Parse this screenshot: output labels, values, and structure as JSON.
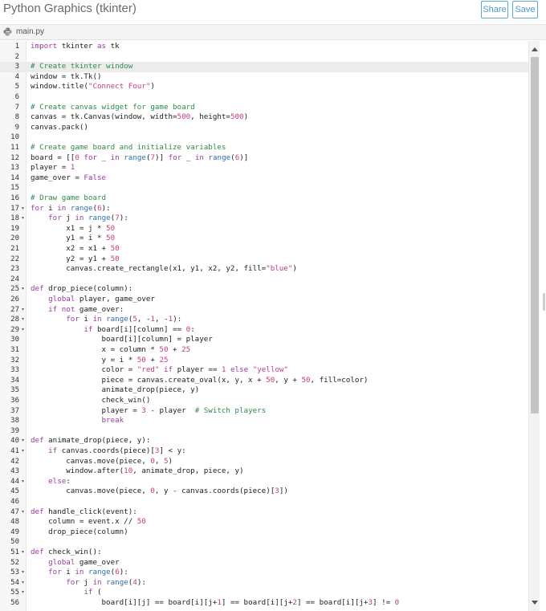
{
  "app": {
    "title": "Python Graphics (tkinter)",
    "share_label": "Share",
    "save_label": "Save"
  },
  "tab": {
    "filename": "main.py",
    "icon": "python-file-icon"
  },
  "editor": {
    "active_line": 3,
    "lines": [
      {
        "n": "1",
        "fold": false,
        "text": "import tkinter as tk"
      },
      {
        "n": "2",
        "fold": false,
        "text": ""
      },
      {
        "n": "3",
        "fold": false,
        "text": "# Create tkinter window"
      },
      {
        "n": "4",
        "fold": false,
        "text": "window = tk.Tk()"
      },
      {
        "n": "5",
        "fold": false,
        "text": "window.title(\"Connect Four\")"
      },
      {
        "n": "6",
        "fold": false,
        "text": ""
      },
      {
        "n": "7",
        "fold": false,
        "text": "# Create canvas widget for game board"
      },
      {
        "n": "8",
        "fold": false,
        "text": "canvas = tk.Canvas(window, width=500, height=500)"
      },
      {
        "n": "9",
        "fold": false,
        "text": "canvas.pack()"
      },
      {
        "n": "10",
        "fold": false,
        "text": ""
      },
      {
        "n": "11",
        "fold": false,
        "text": "# Create game board and initialize variables"
      },
      {
        "n": "12",
        "fold": false,
        "text": "board = [[0 for _ in range(7)] for _ in range(6)]"
      },
      {
        "n": "13",
        "fold": false,
        "text": "player = 1"
      },
      {
        "n": "14",
        "fold": false,
        "text": "game_over = False"
      },
      {
        "n": "15",
        "fold": false,
        "text": ""
      },
      {
        "n": "16",
        "fold": false,
        "text": "# Draw game board"
      },
      {
        "n": "17",
        "fold": true,
        "text": "for i in range(6):"
      },
      {
        "n": "18",
        "fold": true,
        "text": "    for j in range(7):"
      },
      {
        "n": "19",
        "fold": false,
        "text": "        x1 = j * 50"
      },
      {
        "n": "20",
        "fold": false,
        "text": "        y1 = i * 50"
      },
      {
        "n": "21",
        "fold": false,
        "text": "        x2 = x1 + 50"
      },
      {
        "n": "22",
        "fold": false,
        "text": "        y2 = y1 + 50"
      },
      {
        "n": "23",
        "fold": false,
        "text": "        canvas.create_rectangle(x1, y1, x2, y2, fill=\"blue\")"
      },
      {
        "n": "24",
        "fold": false,
        "text": ""
      },
      {
        "n": "25",
        "fold": true,
        "text": "def drop_piece(column):"
      },
      {
        "n": "26",
        "fold": false,
        "text": "    global player, game_over"
      },
      {
        "n": "27",
        "fold": true,
        "text": "    if not game_over:"
      },
      {
        "n": "28",
        "fold": true,
        "text": "        for i in range(5, -1, -1):"
      },
      {
        "n": "29",
        "fold": true,
        "text": "            if board[i][column] == 0:"
      },
      {
        "n": "30",
        "fold": false,
        "text": "                board[i][column] = player"
      },
      {
        "n": "31",
        "fold": false,
        "text": "                x = column * 50 + 25"
      },
      {
        "n": "32",
        "fold": false,
        "text": "                y = i * 50 + 25"
      },
      {
        "n": "33",
        "fold": false,
        "text": "                color = \"red\" if player == 1 else \"yellow\""
      },
      {
        "n": "34",
        "fold": false,
        "text": "                piece = canvas.create_oval(x, y, x + 50, y + 50, fill=color)"
      },
      {
        "n": "35",
        "fold": false,
        "text": "                animate_drop(piece, y)"
      },
      {
        "n": "36",
        "fold": false,
        "text": "                check_win()"
      },
      {
        "n": "37",
        "fold": false,
        "text": "                player = 3 - player  # Switch players"
      },
      {
        "n": "38",
        "fold": false,
        "text": "                break"
      },
      {
        "n": "39",
        "fold": false,
        "text": ""
      },
      {
        "n": "40",
        "fold": true,
        "text": "def animate_drop(piece, y):"
      },
      {
        "n": "41",
        "fold": true,
        "text": "    if canvas.coords(piece)[3] < y:"
      },
      {
        "n": "42",
        "fold": false,
        "text": "        canvas.move(piece, 0, 5)"
      },
      {
        "n": "43",
        "fold": false,
        "text": "        window.after(10, animate_drop, piece, y)"
      },
      {
        "n": "44",
        "fold": true,
        "text": "    else:"
      },
      {
        "n": "45",
        "fold": false,
        "text": "        canvas.move(piece, 0, y - canvas.coords(piece)[3])"
      },
      {
        "n": "46",
        "fold": false,
        "text": ""
      },
      {
        "n": "47",
        "fold": true,
        "text": "def handle_click(event):"
      },
      {
        "n": "48",
        "fold": false,
        "text": "    column = event.x // 50"
      },
      {
        "n": "49",
        "fold": false,
        "text": "    drop_piece(column)"
      },
      {
        "n": "50",
        "fold": false,
        "text": ""
      },
      {
        "n": "51",
        "fold": true,
        "text": "def check_win():"
      },
      {
        "n": "52",
        "fold": false,
        "text": "    global game_over"
      },
      {
        "n": "53",
        "fold": true,
        "text": "    for i in range(6):"
      },
      {
        "n": "54",
        "fold": true,
        "text": "        for j in range(4):"
      },
      {
        "n": "55",
        "fold": true,
        "text": "            if ("
      },
      {
        "n": "56",
        "fold": false,
        "text": "                board[i][j] == board[i][j+1] == board[i][j+2] == board[i][j+3] != 0"
      }
    ]
  },
  "colors": {
    "keyword": "#9a3b9e",
    "string": "#c23b83",
    "comment": "#2f8a4a",
    "builtin": "#2f6fb0",
    "accent": "#4a9bd0"
  }
}
